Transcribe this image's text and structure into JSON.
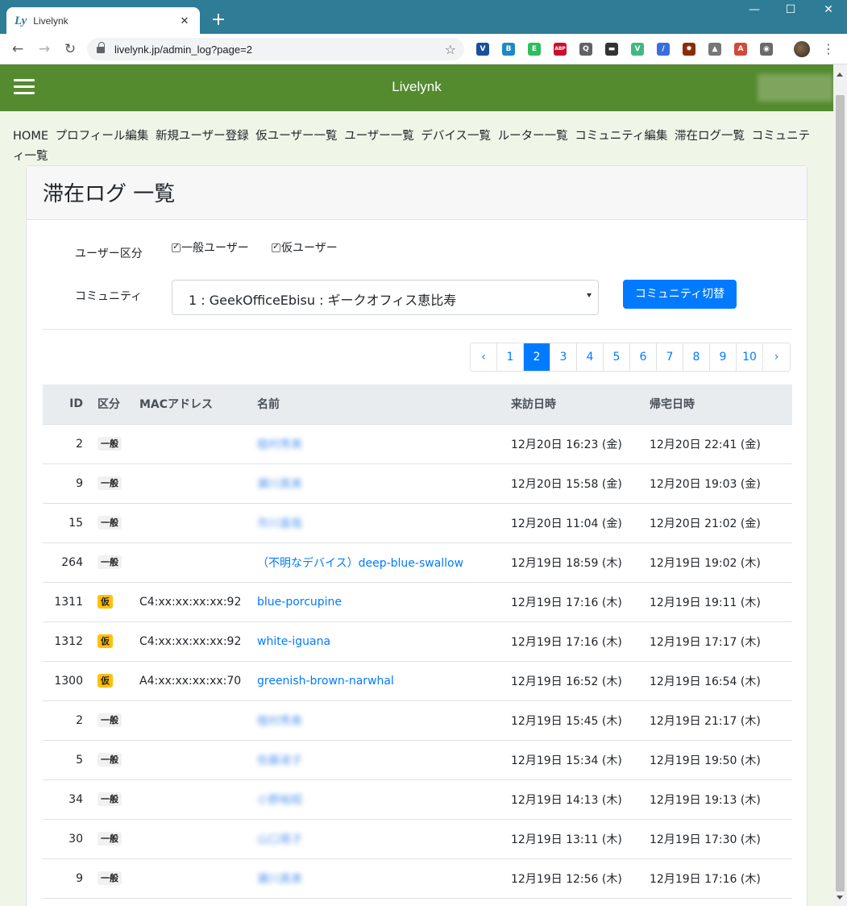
{
  "browser": {
    "tab_title": "Livelynk",
    "favicon_text": "Ly",
    "url": "livelynk.jp/admin_log?page=2",
    "new_tab_symbol": "+",
    "minimize_symbol": "—",
    "maximize_symbol": "☐",
    "close_symbol": "✕",
    "tab_close_symbol": "✕",
    "back_symbol": "←",
    "forward_symbol": "→",
    "reload_symbol": "↻",
    "star_symbol": "☆",
    "menu_symbol": "⋮",
    "extensions": [
      {
        "icon": "vimium-icon",
        "color": "#1a4f9c",
        "label": "V"
      },
      {
        "icon": "hatena-icon",
        "color": "#1e88c8",
        "label": "B"
      },
      {
        "icon": "evernote-icon",
        "color": "#2dbe60",
        "label": "E"
      },
      {
        "icon": "adblock-icon",
        "color": "#c8102e",
        "label": "ABP"
      },
      {
        "icon": "bulb-icon",
        "color": "#5f6368",
        "label": "Q"
      },
      {
        "icon": "terminal-icon",
        "color": "#333333",
        "label": "▬"
      },
      {
        "icon": "vue-icon",
        "color": "#41b883",
        "label": "V"
      },
      {
        "icon": "eyedropper-icon",
        "color": "#3a6edb",
        "label": "/"
      },
      {
        "icon": "addon-icon",
        "color": "#8b2d0a",
        "label": "✹"
      },
      {
        "icon": "drive-icon",
        "color": "#777777",
        "label": "▲"
      },
      {
        "icon": "pdf-icon",
        "color": "#d04a3a",
        "label": "A"
      },
      {
        "icon": "camera-icon",
        "color": "#6a6a6a",
        "label": "◉"
      }
    ]
  },
  "header": {
    "brand": "Livelynk"
  },
  "nav": {
    "items": [
      "HOME",
      "プロフィール編集",
      "新規ユーザー登録",
      "仮ユーザー一覧",
      "ユーザー一覧",
      "デバイス一覧",
      "ルーター一覧",
      "コミュニティ編集",
      "滞在ログ一覧",
      "コミュニティ一覧"
    ]
  },
  "card": {
    "title": "滞在ログ 一覧"
  },
  "filters": {
    "user_type_label": "ユーザー区分",
    "general_user": "一般ユーザー",
    "temp_user": "仮ユーザー",
    "community_label": "コミュニティ",
    "community_selected": "1 : GeekOfficeEbisu : ギークオフィス恵比寿",
    "switch_button": "コミュニティ切替"
  },
  "pagination": {
    "prev": "‹",
    "next": "›",
    "pages": [
      "1",
      "2",
      "3",
      "4",
      "5",
      "6",
      "7",
      "8",
      "9",
      "10"
    ],
    "current": "2"
  },
  "table": {
    "headers": {
      "id": "ID",
      "kind": "区分",
      "mac": "MACアドレス",
      "name": "名前",
      "arrival": "来訪日時",
      "departure": "帰宅日時"
    },
    "rows": [
      {
        "id": "2",
        "kind": "一般",
        "mac": "",
        "name": "植村秀美",
        "blurred": true,
        "arrival": "12月20日 16:23 (金)",
        "departure": "12月20日 22:41 (金)"
      },
      {
        "id": "9",
        "kind": "一般",
        "mac": "",
        "name": "瀬川真美",
        "blurred": true,
        "arrival": "12月20日 15:58 (金)",
        "departure": "12月20日 19:03 (金)"
      },
      {
        "id": "15",
        "kind": "一般",
        "mac": "",
        "name": "市川直哉",
        "blurred": true,
        "arrival": "12月20日 11:04 (金)",
        "departure": "12月20日 21:02 (金)"
      },
      {
        "id": "264",
        "kind": "一般",
        "mac": "",
        "name": "（不明なデバイス）deep-blue-swallow",
        "blurred": false,
        "arrival": "12月19日 18:59 (木)",
        "departure": "12月19日 19:02 (木)"
      },
      {
        "id": "1311",
        "kind": "仮",
        "mac": "C4:xx:xx:xx:xx:92",
        "name": "blue-porcupine",
        "blurred": false,
        "arrival": "12月19日 17:16 (木)",
        "departure": "12月19日 19:11 (木)"
      },
      {
        "id": "1312",
        "kind": "仮",
        "mac": "C4:xx:xx:xx:xx:92",
        "name": "white-iguana",
        "blurred": false,
        "arrival": "12月19日 17:16 (木)",
        "departure": "12月19日 17:17 (木)"
      },
      {
        "id": "1300",
        "kind": "仮",
        "mac": "A4:xx:xx:xx:xx:70",
        "name": "greenish-brown-narwhal",
        "blurred": false,
        "arrival": "12月19日 16:52 (木)",
        "departure": "12月19日 16:54 (木)"
      },
      {
        "id": "2",
        "kind": "一般",
        "mac": "",
        "name": "植村秀美",
        "blurred": true,
        "arrival": "12月19日 15:45 (木)",
        "departure": "12月19日 21:17 (木)"
      },
      {
        "id": "5",
        "kind": "一般",
        "mac": "",
        "name": "佐藤淑子",
        "blurred": true,
        "arrival": "12月19日 15:34 (木)",
        "departure": "12月19日 19:50 (木)"
      },
      {
        "id": "34",
        "kind": "一般",
        "mac": "",
        "name": "小野裕昭",
        "blurred": true,
        "arrival": "12月19日 14:13 (木)",
        "departure": "12月19日 19:13 (木)"
      },
      {
        "id": "30",
        "kind": "一般",
        "mac": "",
        "name": "山口晃子",
        "blurred": true,
        "arrival": "12月19日 13:11 (木)",
        "departure": "12月19日 17:30 (木)"
      },
      {
        "id": "9",
        "kind": "一般",
        "mac": "",
        "name": "瀬川真美",
        "blurred": true,
        "arrival": "12月19日 12:56 (木)",
        "departure": "12月19日 17:16 (木)"
      }
    ]
  }
}
